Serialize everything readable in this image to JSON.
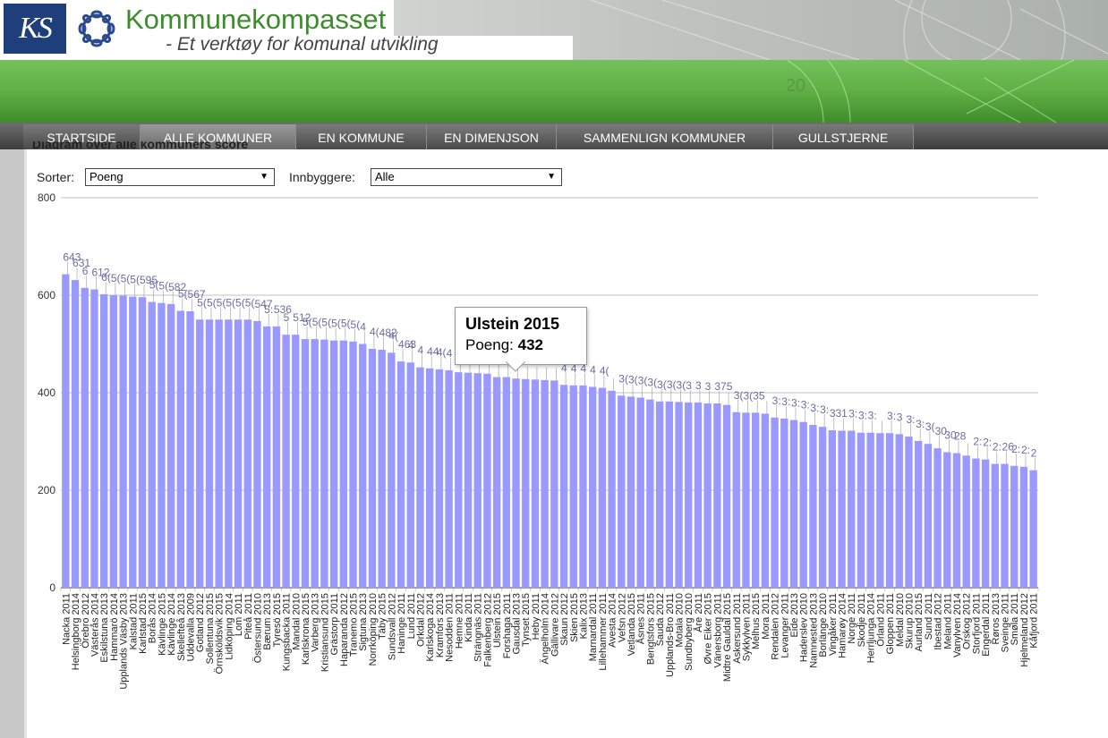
{
  "header": {
    "logo_text": "KS",
    "title": "Kommunekompasset",
    "tagline": "- Et verktøy for komunal utvikling"
  },
  "nav": {
    "tabs": [
      "STARTSIDE",
      "ALLE KOMMUNER",
      "EN KOMMUNE",
      "EN DIMENJSON",
      "SAMMENLIGN KOMMUNER",
      "GULLSTJERNE"
    ],
    "active_index": 1
  },
  "section": {
    "heading": "Diagram over alle kommuners score"
  },
  "controls": {
    "sort_label": "Sorter:",
    "sort_value": "Poeng",
    "pop_label": "Innbyggere:",
    "pop_value": "Alle"
  },
  "tooltip": {
    "title": "Ulstein 2015",
    "label": "Poeng:",
    "value": "432"
  },
  "colors": {
    "bar": "#9999ff",
    "grid": "#c0c0c0",
    "label": "#6a6aa0",
    "accent_green": "#5fb045"
  },
  "chart_data": {
    "type": "bar",
    "ylim": [
      0,
      800
    ],
    "yticks": [
      "0",
      "200",
      "400",
      "600",
      "800"
    ],
    "highlight": "Ulstein 2015",
    "categories": [
      "Nacka 2011",
      "Helsingborg 2014",
      "Örebro 2012",
      "Västerås 2014",
      "Eskilstuna 2013",
      "Hammarö 2014",
      "Upplands Väsby 2013",
      "Kalstad 2011",
      "Karlstad 2015",
      "Borås 2014",
      "Kävlinge 2015",
      "Kävlinge 2014",
      "Skellefteå 2013",
      "Uddevalla 2009",
      "Gotland 2012",
      "Sollentuna 2015",
      "Örnsköldsvik 2015",
      "Lidköping 2014",
      "Lom 2011",
      "Piteå 2011",
      "Östersund 2010",
      "Bærum 2013",
      "Tyresö 2015",
      "Kungsbacka 2011",
      "Mandal 2010",
      "Karlskrona 2015",
      "Varberg 2013",
      "Kristiansund 2015",
      "Grästorp 2011",
      "Haparanda 2012",
      "Tranemo 2015",
      "Sigtuna 2013",
      "Norrköping 2010",
      "Täby 2015",
      "Sundsvall 2012",
      "Haninge 2011",
      "Lund 2011",
      "Orkdal 2012",
      "Karlskoga 2014",
      "Kramfors 2013",
      "Nesodden 2011",
      "Hemne 2011",
      "Kinda 2011",
      "Strängnäs 2011",
      "Falkenberg 2012",
      "Ulstein 2015",
      "Forshaga 2011",
      "Gausdal 2013",
      "Tynset 2015",
      "Heby 2011",
      "Ängelholm 2014",
      "Gällivare 2012",
      "Skaun 2012",
      "Skien 2015",
      "Kalix 2013",
      "Marnardal 2011",
      "Lillehammer 2011",
      "Avesta 2014",
      "Vefsn 2012",
      "Vetlanda 2015",
      "Åsnes 2011",
      "Bengtsfors 2015",
      "Sauda 2012",
      "Upplands-Bro 2011",
      "Motala 2010",
      "Sundbyberg 2010",
      "Åre 2011",
      "Øvre Eiker 2015",
      "Vänersborg 2011",
      "Midtre Gauldal 2015",
      "Askersund 2011",
      "Sykkylven 2011",
      "Melhus 2015",
      "Mora 2011",
      "Rendalen 2012",
      "Levanger 2011",
      "Eide 2013",
      "Haderslev 2010",
      "Namnested 2013",
      "Borlänge 2010",
      "Vingåker 2011",
      "Hamarøy 2014",
      "Norge 2011",
      "Skodje 2011",
      "Herrljunga 2014",
      "Örland 2011",
      "Gloppen 2011",
      "Meldal 2010",
      "Skurup 2010",
      "Aurland 2015",
      "Sund 2011",
      "Ibestad 2012",
      "Meland 2011",
      "Vanylven 2014",
      "Orskog 2012",
      "Storfjord 2011",
      "Engerdal 2011",
      "Røros 2013",
      "Sveinge 2011",
      "Smøla 2011",
      "Hjelmeland 2012",
      "Kåfjord 2011"
    ],
    "values": [
      643,
      631,
      615,
      612,
      602,
      600,
      599,
      597,
      596,
      586,
      584,
      582,
      568,
      567,
      550,
      550,
      550,
      550,
      550,
      550,
      547,
      536,
      536,
      519,
      519,
      510,
      510,
      509,
      507,
      507,
      505,
      500,
      490,
      488,
      482,
      464,
      462,
      452,
      450,
      448,
      446,
      442,
      441,
      440,
      439,
      432,
      432,
      429,
      428,
      427,
      426,
      425,
      416,
      415,
      415,
      412,
      410,
      404,
      394,
      392,
      390,
      386,
      382,
      382,
      381,
      380,
      380,
      378,
      378,
      375,
      360,
      359,
      359,
      357,
      349,
      347,
      344,
      340,
      334,
      330,
      323,
      322,
      322,
      318,
      318,
      317,
      317,
      315,
      310,
      301,
      295,
      286,
      278,
      276,
      271,
      265,
      263,
      254,
      254,
      250,
      248,
      241
    ],
    "value_labels": [
      "643",
      "631",
      "6",
      "612",
      "6(",
      "5(",
      "5(",
      "5(",
      "595",
      "5(",
      "5(",
      "582",
      "5(",
      "567",
      "5(",
      "5(",
      "5(",
      "5(",
      "5(",
      "5(",
      "547",
      "5:",
      "536",
      "5",
      "512",
      "5(",
      "5(",
      "5(",
      "5(",
      "5(",
      "5(",
      "4",
      "4(",
      "482",
      "4(",
      "463",
      "4",
      "4",
      "44",
      "4(",
      "4",
      "4(",
      "",
      "",
      "",
      "432",
      "",
      "",
      "",
      "",
      "",
      "",
      "4",
      "4",
      "4",
      "4",
      "4(",
      "",
      "3(",
      "3(",
      "3(",
      "3(",
      "3(",
      "3(",
      "3(",
      "3",
      "3",
      "3",
      "375",
      "",
      "3(",
      "3(",
      "35",
      "",
      "3:",
      "3:",
      "3:",
      "3:",
      "3:",
      "3:",
      "331",
      "",
      "3:",
      "3:",
      "3:",
      "",
      "3:",
      "3",
      "3:",
      "3:",
      "3(",
      "30",
      "30",
      "28",
      "",
      "2:",
      "2:",
      "2:",
      "26",
      "2:",
      "2:",
      "2",
      "25",
      "2:",
      "2:",
      "2:",
      "2:",
      "241"
    ]
  }
}
